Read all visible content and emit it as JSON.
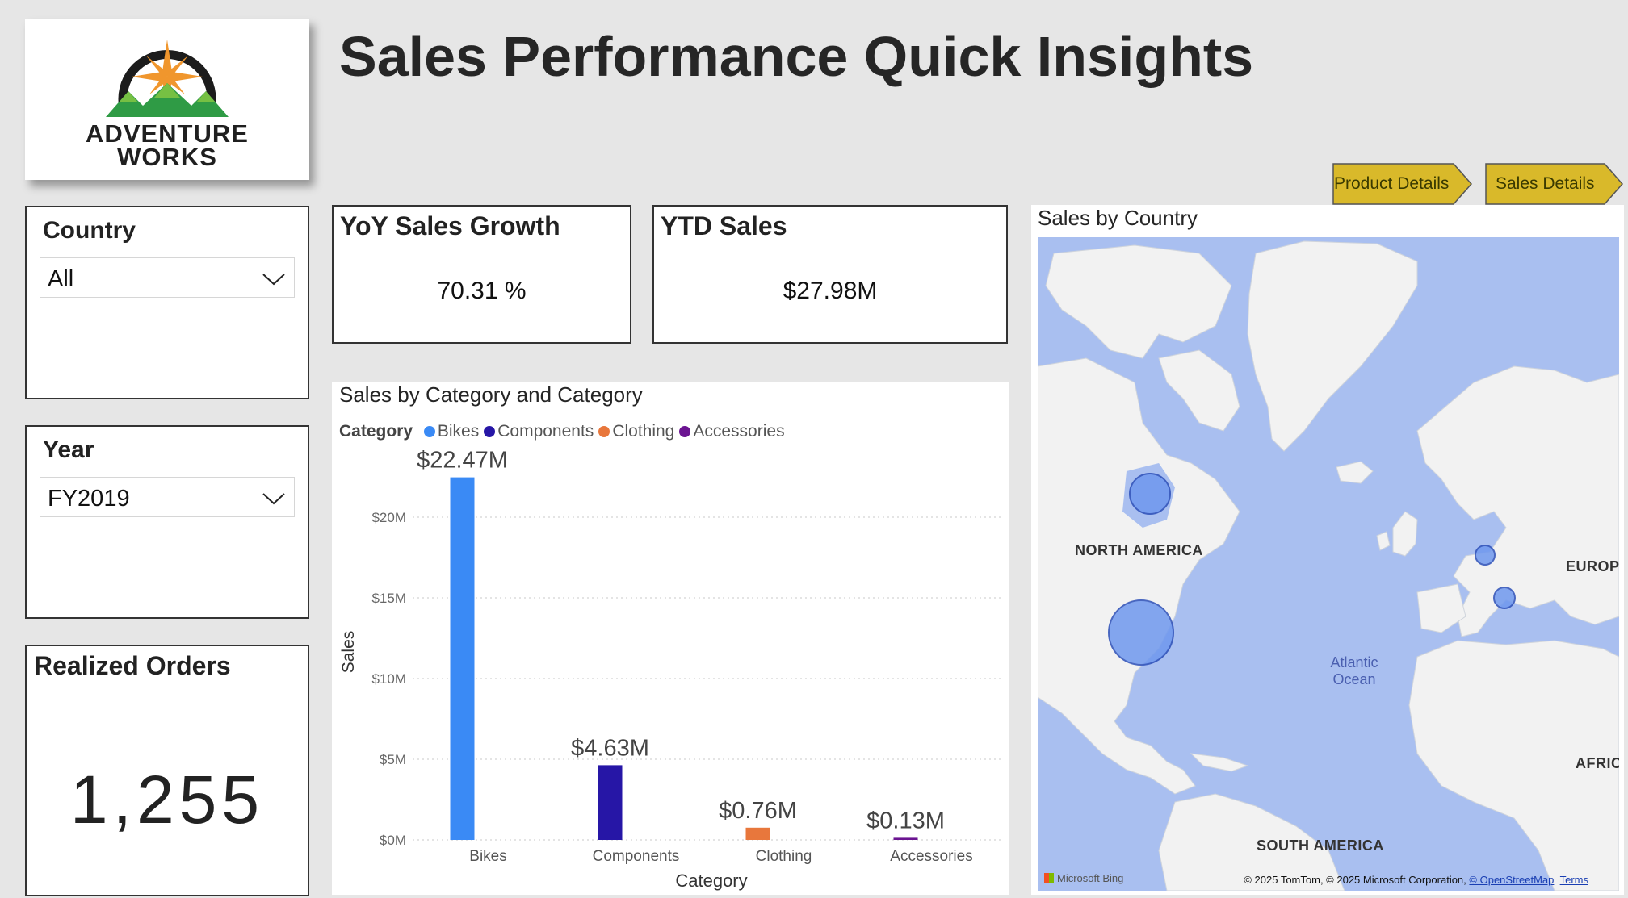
{
  "logo": {
    "line1": "ADVENTURE",
    "line2": "WORKS"
  },
  "title": "Sales Performance Quick Insights",
  "nav": {
    "product_details": "Product Details",
    "sales_details": "Sales Details"
  },
  "slicers": {
    "country": {
      "label": "Country",
      "value": "All"
    },
    "year": {
      "label": "Year",
      "value": "FY2019"
    }
  },
  "kpis": {
    "yoy": {
      "label": "YoY Sales Growth",
      "value": "70.31 %"
    },
    "ytd": {
      "label": "YTD Sales",
      "value": "$27.98M"
    },
    "orders": {
      "label": "Realized Orders",
      "value": "1,255"
    }
  },
  "chart": {
    "title": "Sales by Category and Category",
    "legend_title": "Category",
    "xlabel": "Category",
    "ylabel": "Sales"
  },
  "chart_data": {
    "type": "bar",
    "categories": [
      "Bikes",
      "Components",
      "Clothing",
      "Accessories"
    ],
    "values": [
      22.47,
      4.63,
      0.76,
      0.13
    ],
    "data_labels": [
      "$22.47M",
      "$4.63M",
      "$0.76M",
      "$0.13M"
    ],
    "colors": [
      "#3a8af5",
      "#2616a6",
      "#e8773c",
      "#6b1491"
    ],
    "yticks": [
      "$0M",
      "$5M",
      "$10M",
      "$15M",
      "$20M"
    ],
    "ytick_values": [
      0,
      5,
      10,
      15,
      20
    ],
    "ylim": [
      0,
      24
    ],
    "title": "Sales by Category and Category",
    "xlabel": "Category",
    "ylabel": "Sales",
    "grid": true,
    "legend": "top-left"
  },
  "map": {
    "title": "Sales by Country",
    "labels": {
      "north_america": "NORTH AMERICA",
      "south_america": "SOUTH AMERICA",
      "europe": "EUROPI",
      "africa": "AFRIC/",
      "ocean": "Atlantic Ocean"
    },
    "attribution": {
      "text": "© 2025 TomTom, © 2025 Microsoft Corporation,",
      "osm": "© OpenStreetMap",
      "terms": "Terms"
    },
    "bing": "Microsoft Bing"
  },
  "colors": {
    "background": "#e6e6e6",
    "nav_button": "#d9b92a",
    "bubble": "#6f98ee",
    "map_water": "#a9bff0",
    "map_land": "#f2f2f2"
  }
}
